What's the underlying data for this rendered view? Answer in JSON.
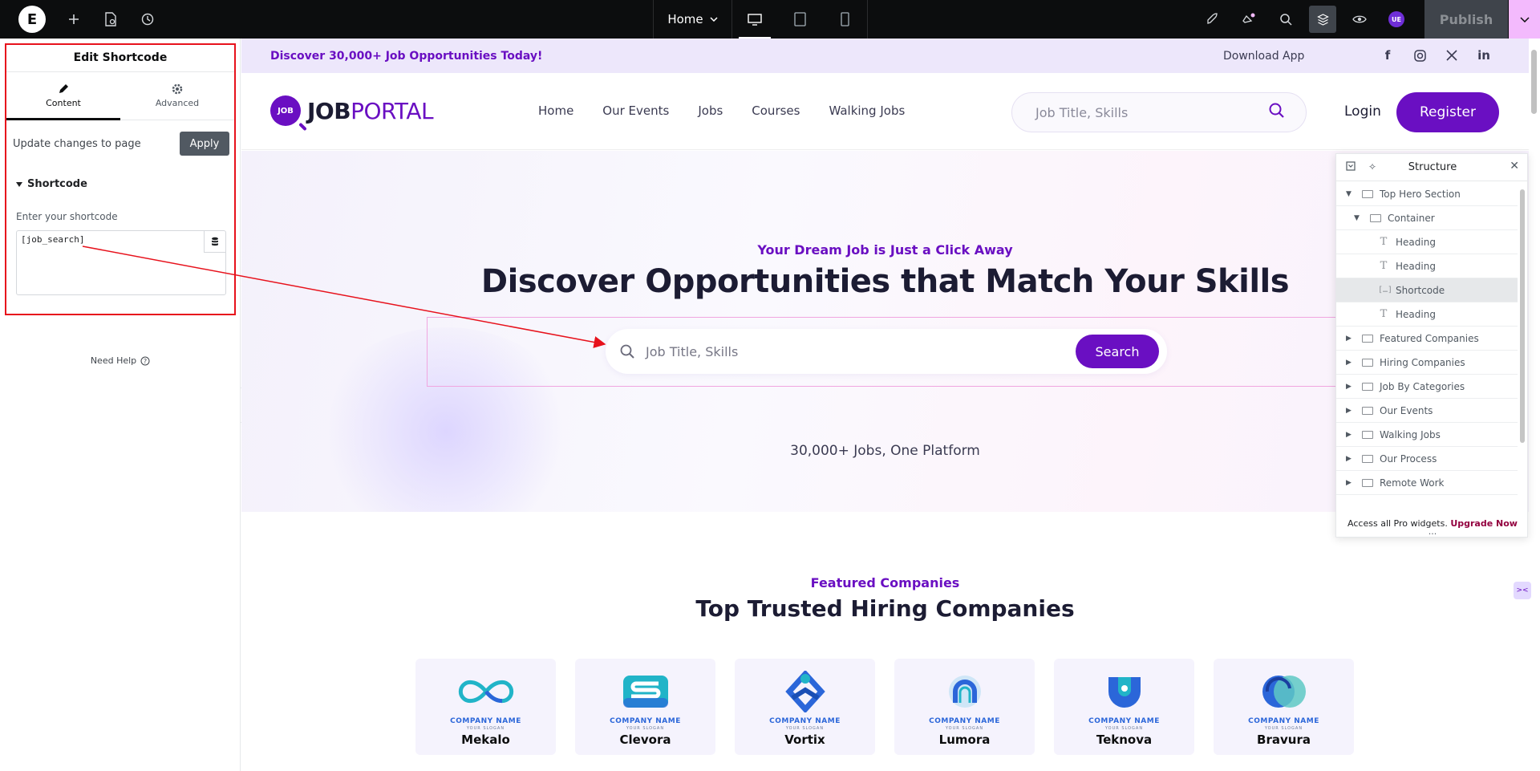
{
  "topbar": {
    "page_name": "Home",
    "publish_label": "Publish",
    "user_initials": "UE"
  },
  "panel": {
    "title": "Edit Shortcode",
    "tabs": [
      {
        "label": "Content"
      },
      {
        "label": "Advanced"
      }
    ],
    "update_text": "Update changes to page",
    "apply_label": "Apply",
    "section_title": "Shortcode",
    "field_label": "Enter your shortcode",
    "shortcode_value": "[job_search]",
    "need_help": "Need Help"
  },
  "site": {
    "announcement": "Discover 30,000+ Job Opportunities Today!",
    "download_app": "Download App",
    "brand_mark": "JOB",
    "brand_job": "JOB",
    "brand_portal": "PORTAL",
    "nav": [
      "Home",
      "Our Events",
      "Jobs",
      "Courses",
      "Walking Jobs"
    ],
    "search_placeholder": "Job Title, Skills",
    "login": "Login",
    "register": "Register",
    "hero_sub": "Your Dream Job is Just a Click Away",
    "hero_title": "Discover Opportunities that Match Your Skills",
    "hero_search_placeholder": "Job Title, Skills",
    "hero_search_button": "Search",
    "hero_count": "30,000+ Jobs, One Platform",
    "featured_sub": "Featured Companies",
    "featured_title": "Top Trusted Hiring Companies",
    "company_label": "COMPANY NAME",
    "company_slogan": "YOUR SLOGAN",
    "companies": [
      "Mekalo",
      "Clevora",
      "Vortix",
      "Lumora",
      "Teknova",
      "Bravura"
    ]
  },
  "structure": {
    "title": "Structure",
    "items": [
      {
        "label": "Top Hero Section",
        "depth": 0,
        "expanded": true,
        "icon": "container"
      },
      {
        "label": "Container",
        "depth": 1,
        "expanded": true,
        "icon": "container"
      },
      {
        "label": "Heading",
        "depth": 2,
        "icon": "heading"
      },
      {
        "label": "Heading",
        "depth": 2,
        "icon": "heading"
      },
      {
        "label": "Shortcode",
        "depth": 2,
        "icon": "shortcode",
        "selected": true
      },
      {
        "label": "Heading",
        "depth": 2,
        "icon": "heading"
      },
      {
        "label": "Featured Companies",
        "depth": 0,
        "icon": "container"
      },
      {
        "label": "Hiring Companies",
        "depth": 0,
        "icon": "container"
      },
      {
        "label": "Job By Categories",
        "depth": 0,
        "icon": "container"
      },
      {
        "label": "Our Events",
        "depth": 0,
        "icon": "container"
      },
      {
        "label": "Walking Jobs",
        "depth": 0,
        "icon": "container"
      },
      {
        "label": "Our Process",
        "depth": 0,
        "icon": "container"
      },
      {
        "label": "Remote Work",
        "depth": 0,
        "icon": "container"
      }
    ],
    "footer_text": "Access all Pro widgets.",
    "upgrade_label": "Upgrade Now"
  },
  "colors": {
    "accent": "#6a0fc2",
    "annotation": "#e7121c",
    "topbar": "#0c0d0e",
    "pro": "#93003f"
  }
}
